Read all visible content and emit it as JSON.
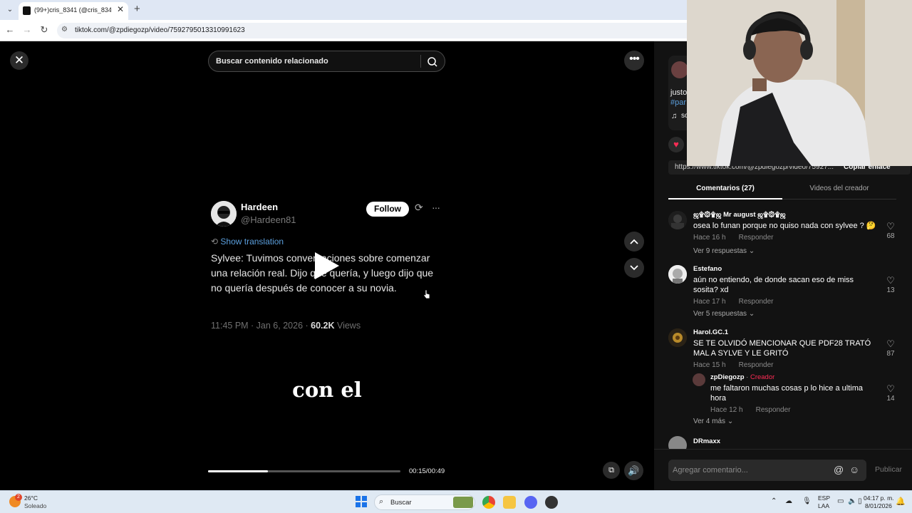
{
  "browser": {
    "tab_title": "(99+)cris_8341 (@cris_8341",
    "url": "tiktok.com/@zpdiegozp/video/7592795013310991623"
  },
  "search": {
    "placeholder": "Buscar contenido relacionado"
  },
  "tweet": {
    "name": "Hardeen",
    "handle": "@Hardeen81",
    "follow_label": "Follow",
    "show_translation": "Show translation",
    "text": "Sylvee: Tuvimos conversaciones sobre comenzar una relación real. Dijo que quería, y luego dijo que no quería después de conocer a su novia.",
    "timestamp": "11:45 PM · Jan 6, 2026 · ",
    "views_count": "60.2K",
    "views_label": " Views"
  },
  "video": {
    "caption": "con el",
    "time": "00:15/00:49",
    "progress": 0.31
  },
  "right_panel": {
    "desc_fragment": "justo",
    "hashtag_fragment": "#par",
    "music_fragment": "so",
    "link_text": "https://www.tiktok.com/@zpdiegozp/video/75927...",
    "copy_link": "Copiar enlace",
    "tab_comments": "Comentarios (27)",
    "tab_videos": "Videos del creador",
    "comments": [
      {
        "user": "ஜ۩۞۩ஜ Mr august ஜ۩۞۩ஜ",
        "text": "osea lo funan porque no quiso nada con sylvee ? 🤔",
        "time": "Hace 16 h",
        "reply": "Responder",
        "likes": "68",
        "more": "Ver 9 respuestas"
      },
      {
        "user": "Estefano",
        "text": "aún no entiendo, de donde sacan eso de miss sosita? xd",
        "time": "Hace 17 h",
        "reply": "Responder",
        "likes": "13",
        "more": "Ver 5 respuestas"
      },
      {
        "user": "Harol.GC.1",
        "text": "SE TE OLVIDÓ MENCIONAR QUE PDF28 TRATÓ MAL A SYLVE Y LE GRITÓ",
        "time": "Hace 15 h",
        "reply": "Responder",
        "likes": "87",
        "more": "Ver 4 más"
      },
      {
        "user": "DRmaxx"
      }
    ],
    "reply": {
      "user": "zpDiegozp",
      "badge": "Creador",
      "text": "me faltaron muchas cosas p lo hice a ultima hora",
      "time": "Hace 12 h",
      "reply": "Responder",
      "likes": "14"
    },
    "comment_placeholder": "Agregar comentario...",
    "publish": "Publicar"
  },
  "taskbar": {
    "weather_temp": "26°C",
    "weather_desc": "Soleado",
    "weather_badge": "2",
    "search_label": "Buscar",
    "lang_top": "ESP",
    "lang_bottom": "LAA",
    "clock_time": "04:17 p. m.",
    "clock_date": "8/01/2026"
  },
  "colors": {
    "accent": "#fe2c55",
    "link": "#5b9fdd"
  }
}
